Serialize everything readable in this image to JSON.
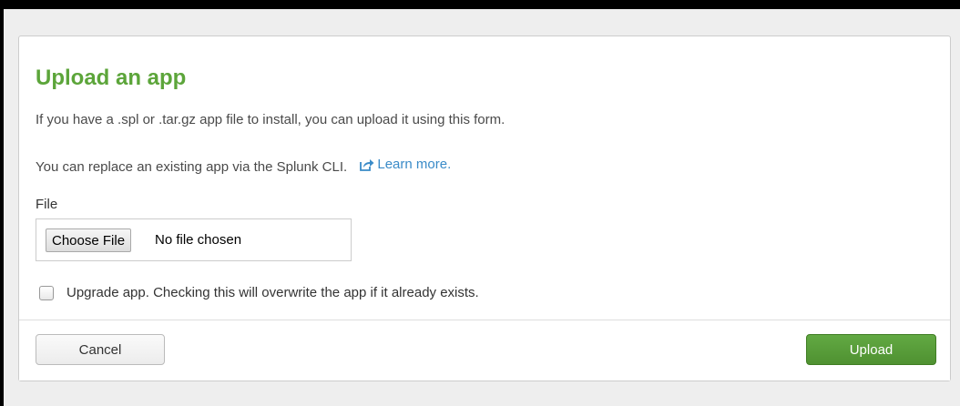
{
  "dialog": {
    "title": "Upload an app",
    "description": "If you have a .spl or .tar.gz app file to install, you can upload it using this form.",
    "replace_text": "You can replace an existing app via the Splunk CLI.",
    "learn_more_label": "Learn more.",
    "learn_more_icon": "external-link-icon",
    "accent_color": "#5ca53a",
    "link_color": "#3a8bc8"
  },
  "file_field": {
    "label": "File",
    "button_label": "Choose File",
    "status_text": "No file chosen"
  },
  "upgrade_option": {
    "checked": false,
    "label": "Upgrade app. Checking this will overwrite the app if it already exists."
  },
  "footer": {
    "cancel_label": "Cancel",
    "upload_label": "Upload",
    "upload_color": "#5a9f3b"
  }
}
